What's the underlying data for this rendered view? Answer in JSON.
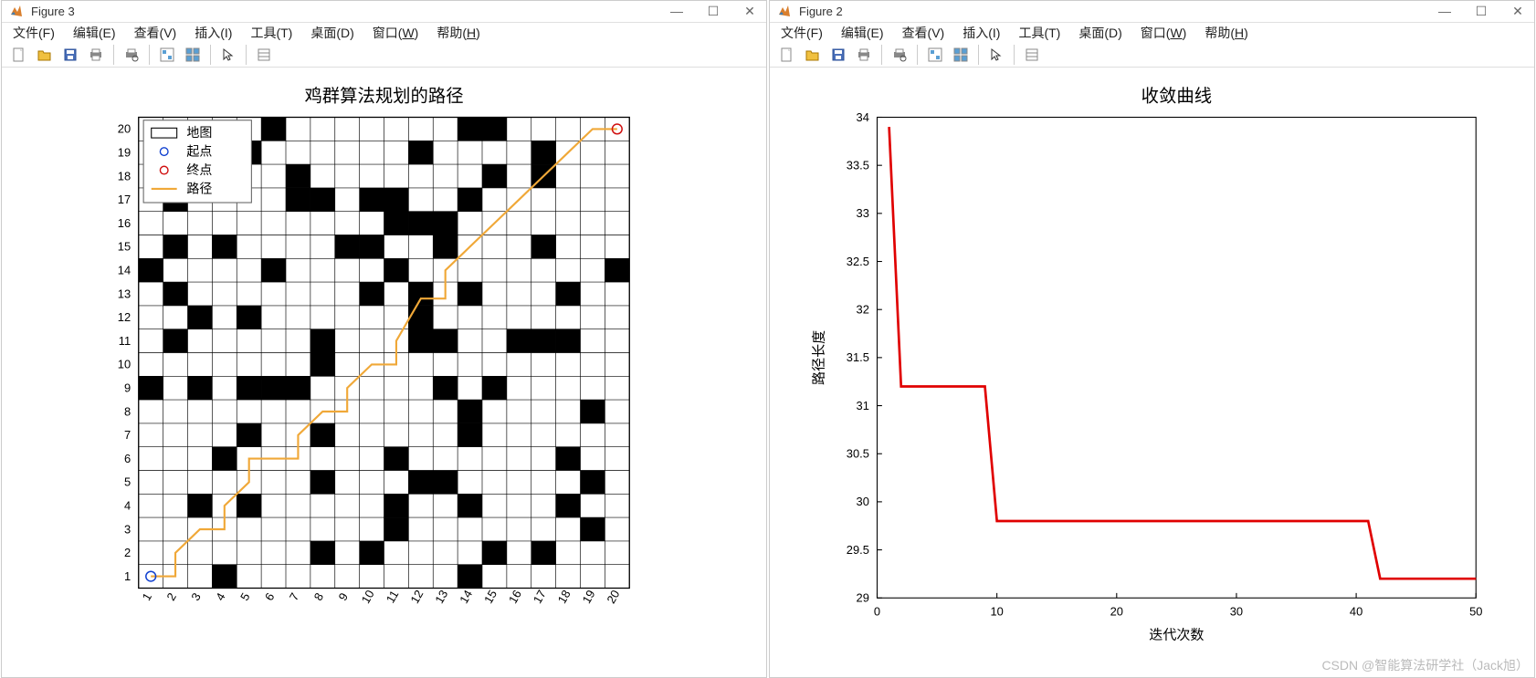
{
  "figures": [
    {
      "title": "Figure 3"
    },
    {
      "title": "Figure 2"
    }
  ],
  "menus": [
    "文件(F)",
    "编辑(E)",
    "查看(V)",
    "插入(I)",
    "工具(T)",
    "桌面(D)",
    "窗口(W)",
    "帮助(H)"
  ],
  "toolbar_icons": [
    "new-file-icon",
    "open-icon",
    "save-icon",
    "print-icon",
    "print-preview-icon",
    "linked-axes-icon",
    "plot-tools-icon",
    "cursor-icon",
    "data-tips-icon"
  ],
  "watermark": "CSDN @智能算法研学社（Jack旭）",
  "chart_data": [
    {
      "type": "heatmap",
      "title": "鸡群算法规划的路径",
      "xlim": [
        1,
        20
      ],
      "ylim": [
        1,
        20
      ],
      "x_ticks": [
        1,
        2,
        3,
        4,
        5,
        6,
        7,
        8,
        9,
        10,
        11,
        12,
        13,
        14,
        15,
        16,
        17,
        18,
        19,
        20
      ],
      "y_ticks": [
        1,
        2,
        3,
        4,
        5,
        6,
        7,
        8,
        9,
        10,
        11,
        12,
        13,
        14,
        15,
        16,
        17,
        18,
        19,
        20
      ],
      "legend": [
        "地图",
        "起点",
        "终点",
        "路径"
      ],
      "start": [
        1,
        1
      ],
      "end": [
        20,
        20
      ],
      "obstacles": [
        [
          4,
          1
        ],
        [
          14,
          1
        ],
        [
          8,
          2
        ],
        [
          10,
          2
        ],
        [
          15,
          2
        ],
        [
          17,
          2
        ],
        [
          11,
          3
        ],
        [
          19,
          3
        ],
        [
          3,
          4
        ],
        [
          5,
          4
        ],
        [
          11,
          4
        ],
        [
          14,
          4
        ],
        [
          18,
          4
        ],
        [
          8,
          5
        ],
        [
          12,
          5
        ],
        [
          13,
          5
        ],
        [
          19,
          5
        ],
        [
          4,
          6
        ],
        [
          11,
          6
        ],
        [
          18,
          6
        ],
        [
          5,
          7
        ],
        [
          8,
          7
        ],
        [
          14,
          7
        ],
        [
          14,
          8
        ],
        [
          19,
          8
        ],
        [
          1,
          9
        ],
        [
          3,
          9
        ],
        [
          5,
          9
        ],
        [
          6,
          9
        ],
        [
          7,
          9
        ],
        [
          13,
          9
        ],
        [
          15,
          9
        ],
        [
          8,
          10
        ],
        [
          2,
          11
        ],
        [
          8,
          11
        ],
        [
          12,
          11
        ],
        [
          13,
          11
        ],
        [
          16,
          11
        ],
        [
          17,
          11
        ],
        [
          18,
          11
        ],
        [
          3,
          12
        ],
        [
          5,
          12
        ],
        [
          12,
          12
        ],
        [
          2,
          13
        ],
        [
          10,
          13
        ],
        [
          12,
          13
        ],
        [
          14,
          13
        ],
        [
          18,
          13
        ],
        [
          1,
          14
        ],
        [
          6,
          14
        ],
        [
          11,
          14
        ],
        [
          20,
          14
        ],
        [
          2,
          15
        ],
        [
          4,
          15
        ],
        [
          9,
          15
        ],
        [
          10,
          15
        ],
        [
          13,
          15
        ],
        [
          17,
          15
        ],
        [
          11,
          16
        ],
        [
          12,
          16
        ],
        [
          13,
          16
        ],
        [
          2,
          17
        ],
        [
          7,
          17
        ],
        [
          8,
          17
        ],
        [
          10,
          17
        ],
        [
          11,
          17
        ],
        [
          14,
          17
        ],
        [
          3,
          18
        ],
        [
          4,
          18
        ],
        [
          7,
          18
        ],
        [
          15,
          18
        ],
        [
          17,
          18
        ],
        [
          5,
          19
        ],
        [
          12,
          19
        ],
        [
          17,
          19
        ],
        [
          6,
          20
        ],
        [
          14,
          20
        ],
        [
          15,
          20
        ]
      ],
      "path": [
        [
          1,
          1
        ],
        [
          2,
          1
        ],
        [
          2,
          2
        ],
        [
          3,
          3
        ],
        [
          4,
          3
        ],
        [
          4,
          4
        ],
        [
          5,
          5
        ],
        [
          5,
          6
        ],
        [
          6,
          6
        ],
        [
          7,
          6
        ],
        [
          7,
          7
        ],
        [
          8,
          8
        ],
        [
          9,
          8
        ],
        [
          9,
          9
        ],
        [
          10,
          10
        ],
        [
          11,
          10
        ],
        [
          11,
          11
        ],
        [
          12,
          12.8
        ],
        [
          13,
          12.8
        ],
        [
          13,
          14
        ],
        [
          14,
          15
        ],
        [
          15,
          16
        ],
        [
          16,
          17
        ],
        [
          17,
          18
        ],
        [
          18,
          19
        ],
        [
          19,
          20
        ],
        [
          20,
          20
        ]
      ]
    },
    {
      "type": "line",
      "title": "收敛曲线",
      "xlabel": "迭代次数",
      "ylabel": "路径长度",
      "xlim": [
        0,
        50
      ],
      "ylim": [
        29,
        34
      ],
      "x_ticks": [
        0,
        10,
        20,
        30,
        40,
        50
      ],
      "y_ticks": [
        29,
        29.5,
        30,
        30.5,
        31,
        31.5,
        32,
        32.5,
        33,
        33.5,
        34
      ],
      "series": [
        {
          "name": "收敛曲线",
          "x": [
            1,
            2,
            3,
            9,
            10,
            41,
            42,
            50
          ],
          "values": [
            33.9,
            31.2,
            31.2,
            31.2,
            29.8,
            29.8,
            29.2,
            29.2
          ]
        }
      ]
    }
  ]
}
